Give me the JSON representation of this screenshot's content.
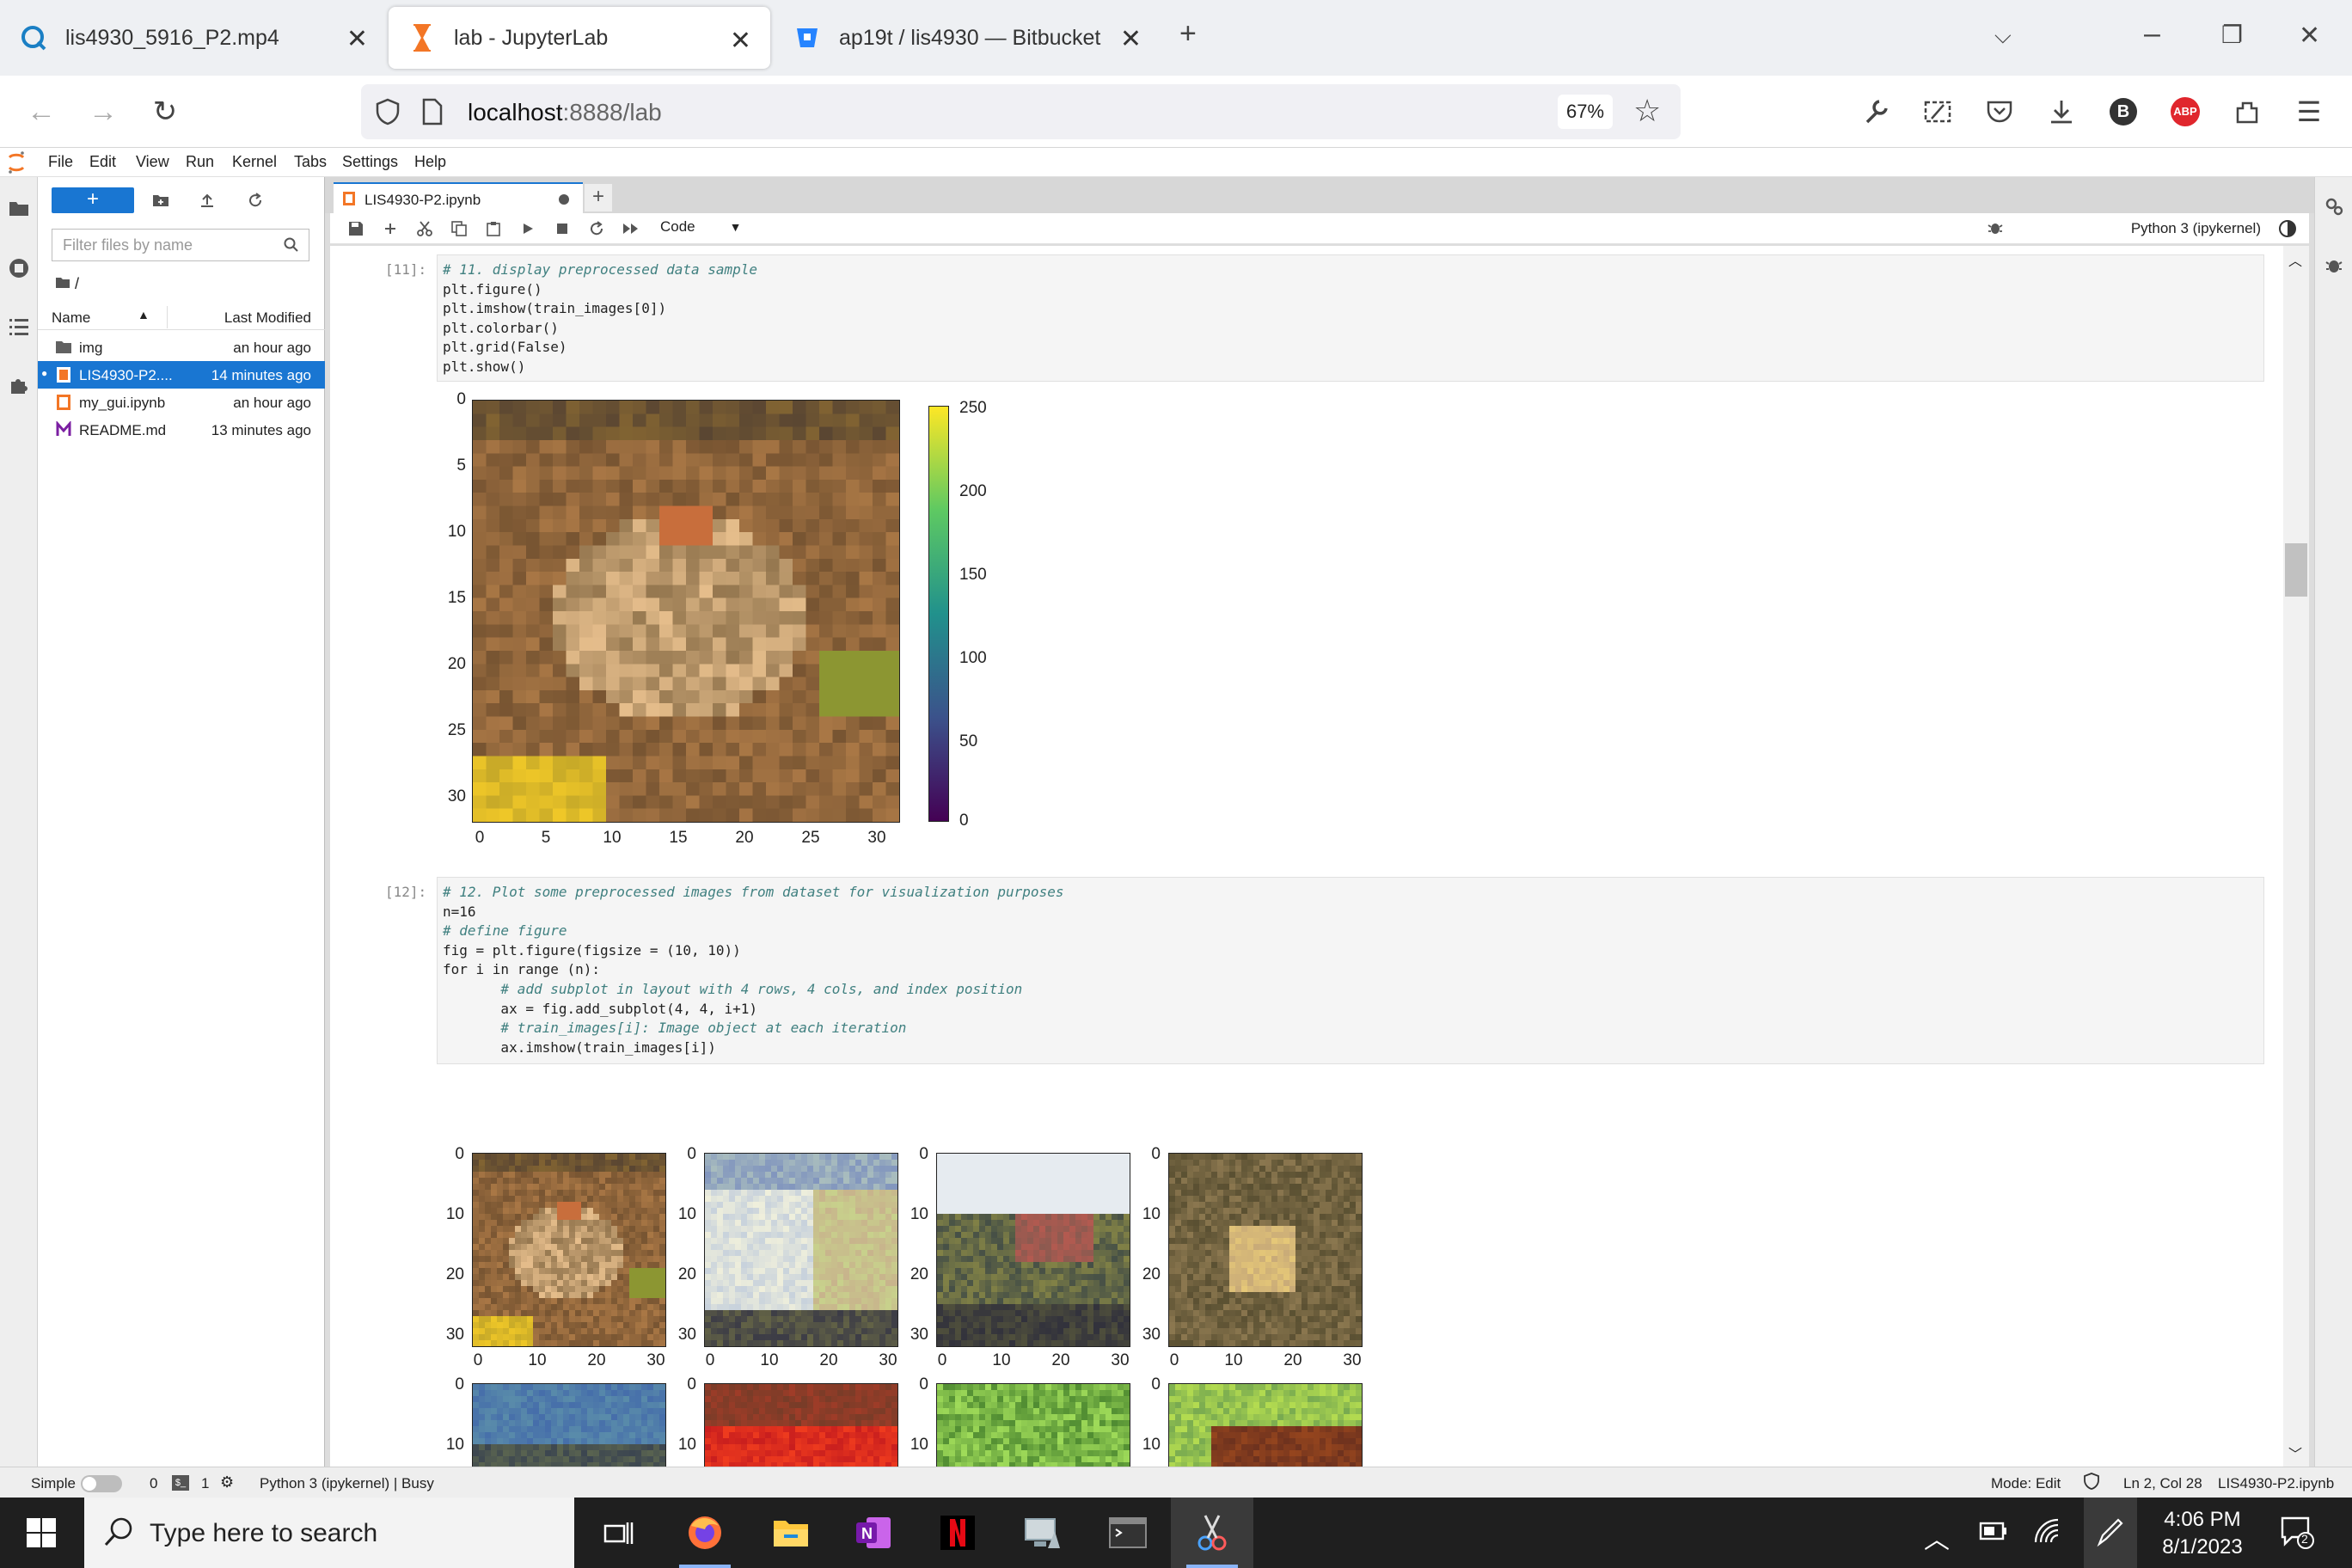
{
  "browser": {
    "tabs": [
      {
        "title": "lis4930_5916_P2.mp4",
        "icon": "quicktime-icon"
      },
      {
        "title": "lab - JupyterLab",
        "icon": "hourglass-icon",
        "active": true
      },
      {
        "title": "ap19t / lis4930 — Bitbucket",
        "icon": "bitbucket-icon"
      }
    ],
    "url_host": "localhost",
    "url_rest": ":8888/lab",
    "zoom": "67%",
    "profile_letter": "B",
    "abp_label": "ABP"
  },
  "jupyter": {
    "menu": [
      "File",
      "Edit",
      "View",
      "Run",
      "Kernel",
      "Tabs",
      "Settings",
      "Help"
    ],
    "new_button": "+",
    "filter_placeholder": "Filter files by name",
    "breadcrumb": "/",
    "columns": {
      "name": "Name",
      "modified": "Last Modified"
    },
    "files": [
      {
        "name": "img",
        "modified": "an hour ago",
        "type": "folder"
      },
      {
        "name": "LIS4930-P2....",
        "modified": "14 minutes ago",
        "type": "notebook",
        "selected": true
      },
      {
        "name": "my_gui.ipynb",
        "modified": "an hour ago",
        "type": "notebook"
      },
      {
        "name": "README.md",
        "modified": "13 minutes ago",
        "type": "markdown"
      }
    ],
    "doc_tab": "LIS4930-P2.ipynb",
    "cell_type": "Code",
    "kernel": "Python 3 (ipykernel)"
  },
  "cells": [
    {
      "prompt": "[11]:",
      "lines": [
        "# 11. display preprocessed data sample",
        "plt.figure()",
        "plt.imshow(train_images[0])",
        "plt.colorbar()",
        "plt.grid(False)",
        "plt.show()"
      ]
    },
    {
      "prompt": "[12]:",
      "lines": [
        "# 12. Plot some preprocessed images from dataset for visualization purposes",
        "n=16",
        "# define figure",
        "fig = plt.figure(figsize = (10, 10))",
        "for i in range (n):",
        "       # add subplot in layout with 4 rows, 4 cols, and index position",
        "       ax = fig.add_subplot(4, 4, i+1)",
        "       # train_images[i]: Image object at each iteration",
        "       ax.imshow(train_images[i])"
      ]
    }
  ],
  "plot1": {
    "y_ticks": [
      "0",
      "5",
      "10",
      "15",
      "20",
      "25",
      "30"
    ],
    "x_ticks": [
      "0",
      "5",
      "10",
      "15",
      "20",
      "25",
      "30"
    ],
    "colorbar_ticks": [
      "250",
      "200",
      "150",
      "100",
      "50",
      "0"
    ]
  },
  "grid_plot": {
    "y_ticks": [
      "0",
      "10",
      "20",
      "30"
    ],
    "x_ticks": [
      "0",
      "10",
      "20",
      "30"
    ],
    "images": [
      "frog",
      "truck",
      "truck",
      "deer",
      "automobile",
      "automobile",
      "bird",
      "horse"
    ]
  },
  "status": {
    "mode_label": "Simple",
    "count_a": "0",
    "count_b": "1",
    "kernel_state": "Python 3 (ipykernel) | Busy",
    "mode": "Mode: Edit",
    "position": "Ln 2, Col 28",
    "file": "LIS4930-P2.ipynb"
  },
  "taskbar": {
    "search_placeholder": "Type here to search",
    "time": "4:06 PM",
    "date": "8/1/2023",
    "notifications": "2"
  }
}
